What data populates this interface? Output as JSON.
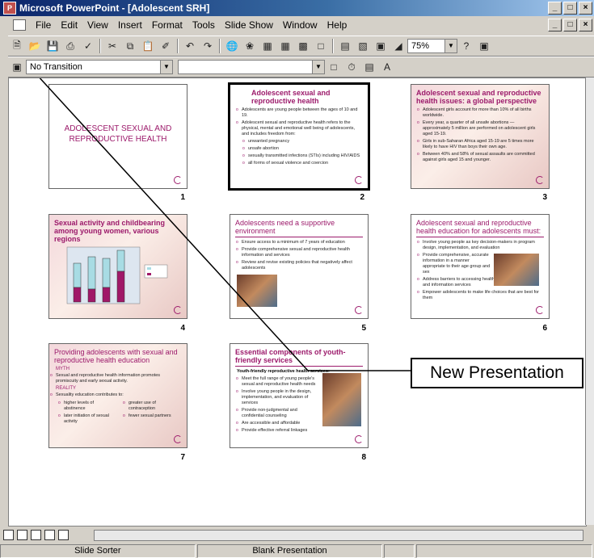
{
  "window": {
    "title": "Microsoft PowerPoint - [Adolescent SRH]",
    "app_icon": "P"
  },
  "window_buttons": {
    "minimize": "_",
    "maximize": "□",
    "close": "×"
  },
  "menu": [
    "File",
    "Edit",
    "View",
    "Insert",
    "Format",
    "Tools",
    "Slide Show",
    "Window",
    "Help"
  ],
  "toolbar": {
    "zoom": "75%"
  },
  "formatting": {
    "transition": "No Transition",
    "effect": ""
  },
  "slides": [
    {
      "number": "1",
      "title": "ADOLESCENT SEXUAL AND REPRODUCTIVE HEALTH"
    },
    {
      "number": "2",
      "title": "Adolescent sexual and reproductive health",
      "lines": [
        "Adolescents are young people between the ages of 10 and 19.",
        "Adolescent sexual and reproductive health refers to the physical, mental and emotional well being of adolescents, and includes freedom from:",
        "unwanted pregnancy",
        "unsafe abortion",
        "sexually transmitted infections (STIs) including HIV/AIDS",
        "all forms of sexual violence and coercion"
      ]
    },
    {
      "number": "3",
      "title": "Adolescent sexual and reproductive health issues: a global perspective",
      "lines": [
        "Adolescent girls account for more than 10% of all births worldwide.",
        "Every year, a quarter of all unsafe abortions — approximately 5 million are performed on adolescent girls aged 15-19.",
        "Girls in sub-Saharan Africa aged 15-19 are 5 times more likely to have HIV than boys their own age.",
        "Between 40% and 58% of sexual assaults are committed against girls aged 15 and younger."
      ]
    },
    {
      "number": "4",
      "title": "Sexual activity and childbearing among young women, various regions"
    },
    {
      "number": "5",
      "title": "Adolescents need a supportive environment",
      "lines": [
        "Ensure access to a minimum of 7 years of education",
        "Provide comprehensive sexual and reproductive health information and services",
        "Review and revise existing policies that negatively affect adolescents"
      ]
    },
    {
      "number": "6",
      "title": "Adolescent sexual and reproductive health education for adolescents must:",
      "lines": [
        "Involve young people as key decision-makers in program design, implementation, and evaluation",
        "Provide comprehensive, accurate information in a manner appropriate to their age group and sex",
        "Address barriers to accessing health and information services",
        "Empower adolescents to make life choices that are best for them"
      ]
    },
    {
      "number": "7",
      "title": "Providing adolescents with sexual and reproductive health education",
      "lines": [
        "MYTH",
        "Sexual and reproductive health information promotes promiscuity and early sexual activity.",
        "REALITY",
        "Sexuality education contributes to:",
        "higher levels of abstinence",
        "greater use of contraception",
        "later initiation of sexual activity",
        "fewer sexual partners"
      ]
    },
    {
      "number": "8",
      "title": "Essential components of youth-friendly services",
      "lines": [
        "Youth-friendly reproductive health services:",
        "Meet the full range of young people's sexual and reproductive health needs",
        "Involve young people in the design, implementation, and evaluation of services",
        "Provide non-judgmental and confidential counseling",
        "Are accessible and affordable",
        "Provide effective referral linkages"
      ]
    }
  ],
  "callout": {
    "text": "New Presentation"
  },
  "status": {
    "view": "Slide Sorter",
    "template": "Blank Presentation"
  }
}
